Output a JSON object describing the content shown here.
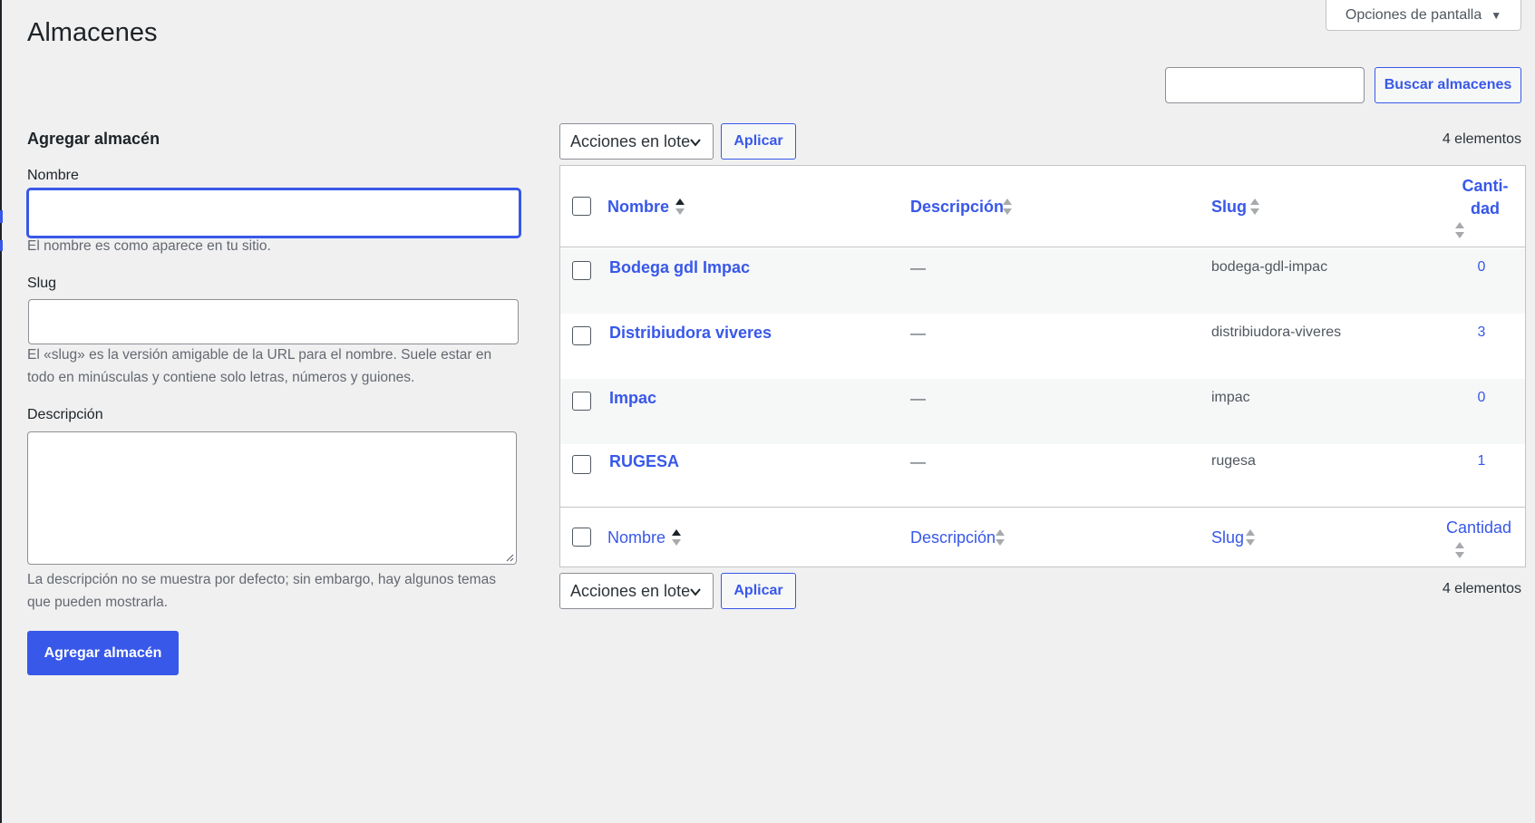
{
  "page": {
    "title": "Almacenes"
  },
  "screen_options": {
    "label": "Opciones de pantalla",
    "icon": "caret-down-icon"
  },
  "search": {
    "value": "",
    "placeholder": "",
    "button_label": "Buscar almacenes"
  },
  "form": {
    "title": "Agregar almacén",
    "name": {
      "label": "Nombre",
      "value": "",
      "help": "El nombre es como aparece en tu sitio."
    },
    "slug": {
      "label": "Slug",
      "value": "",
      "help": "El «slug» es la versión amigable de la URL para el nombre. Suele estar en todo en minúsculas y contiene solo letras, números y guiones."
    },
    "description": {
      "label": "Descripción",
      "value": "",
      "help": "La descripción no se muestra por defecto; sin embargo, hay algunos temas que pueden mostrarla."
    },
    "submit_label": "Agregar almacén"
  },
  "bulk_actions": {
    "top": {
      "selected": "Acciones en lote",
      "apply_label": "Aplicar",
      "count": "4 elementos"
    },
    "bottom": {
      "selected": "Acciones en lote",
      "apply_label": "Aplicar",
      "count": "4 elementos"
    }
  },
  "table": {
    "header": {
      "name": "Nombre",
      "description": "Descripción",
      "slug": "Slug",
      "count_line1": "Canti-",
      "count_line2": "dad"
    },
    "footer": {
      "name": "Nombre",
      "description": "Descripción",
      "slug": "Slug",
      "count": "Cantidad"
    },
    "rows": [
      {
        "name": "Bodega gdl Impac",
        "description": "—",
        "slug": "bodega-gdl-impac",
        "count": "0"
      },
      {
        "name": "Distribiudora viveres",
        "description": "—",
        "slug": "distribiudora-viveres",
        "count": "3"
      },
      {
        "name": "Impac",
        "description": "—",
        "slug": "impac",
        "count": "0"
      },
      {
        "name": "RUGESA",
        "description": "—",
        "slug": "rugesa",
        "count": "1"
      }
    ]
  },
  "colors": {
    "accent": "#3858e9",
    "background": "#f0f0f1",
    "text": "#1d2327",
    "muted": "#646970"
  }
}
